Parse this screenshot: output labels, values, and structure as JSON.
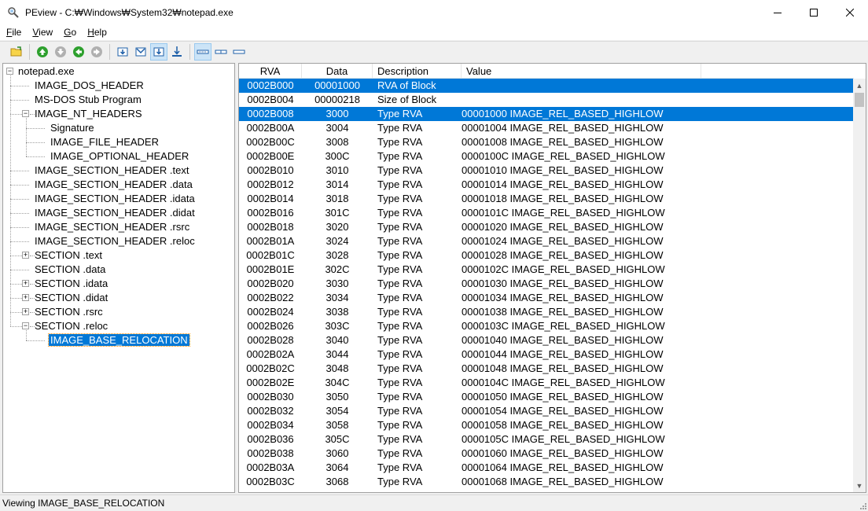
{
  "window": {
    "title": "PEview - C:₩Windows₩System32₩notepad.exe",
    "app_icon": "magnifier-icon",
    "controls": [
      "minimize-icon",
      "maximize-icon",
      "close-icon"
    ]
  },
  "menu": [
    {
      "label": "File",
      "accel": "F",
      "rest": "ile"
    },
    {
      "label": "View",
      "accel": "V",
      "rest": "iew"
    },
    {
      "label": "Go",
      "accel": "G",
      "rest": "o"
    },
    {
      "label": "Help",
      "accel": "H",
      "rest": "elp"
    }
  ],
  "toolbar": {
    "buttons": [
      {
        "name": "open-file-icon"
      },
      {
        "name": "go-up-icon"
      },
      {
        "name": "go-down-icon"
      },
      {
        "name": "go-back-icon"
      },
      {
        "name": "go-forward-icon"
      },
      {
        "name": "view-byte-icon"
      },
      {
        "name": "view-word-icon"
      },
      {
        "name": "view-dword-icon",
        "pressed": true
      },
      {
        "name": "view-address-icon"
      },
      {
        "name": "view-details-icon",
        "pressed": true
      },
      {
        "name": "view-compact-icon"
      },
      {
        "name": "view-single-icon"
      }
    ]
  },
  "tree": {
    "items": [
      {
        "label": "notepad.exe",
        "level": 0,
        "expander": "-"
      },
      {
        "label": "IMAGE_DOS_HEADER",
        "level": 1
      },
      {
        "label": "MS-DOS Stub Program",
        "level": 1
      },
      {
        "label": "IMAGE_NT_HEADERS",
        "level": 1,
        "expander": "-"
      },
      {
        "label": "Signature",
        "level": 2
      },
      {
        "label": "IMAGE_FILE_HEADER",
        "level": 2
      },
      {
        "label": "IMAGE_OPTIONAL_HEADER",
        "level": 2
      },
      {
        "label": "IMAGE_SECTION_HEADER .text",
        "level": 1
      },
      {
        "label": "IMAGE_SECTION_HEADER .data",
        "level": 1
      },
      {
        "label": "IMAGE_SECTION_HEADER .idata",
        "level": 1
      },
      {
        "label": "IMAGE_SECTION_HEADER .didat",
        "level": 1
      },
      {
        "label": "IMAGE_SECTION_HEADER .rsrc",
        "level": 1
      },
      {
        "label": "IMAGE_SECTION_HEADER .reloc",
        "level": 1
      },
      {
        "label": "SECTION .text",
        "level": 1,
        "expander": "+"
      },
      {
        "label": "SECTION .data",
        "level": 1
      },
      {
        "label": "SECTION .idata",
        "level": 1,
        "expander": "+"
      },
      {
        "label": "SECTION .didat",
        "level": 1,
        "expander": "+"
      },
      {
        "label": "SECTION .rsrc",
        "level": 1,
        "expander": "+"
      },
      {
        "label": "SECTION .reloc",
        "level": 1,
        "expander": "-"
      },
      {
        "label": "IMAGE_BASE_RELOCATION",
        "level": 2,
        "selected": true
      }
    ]
  },
  "list": {
    "columns": [
      "RVA",
      "Data",
      "Description",
      "Value"
    ],
    "rows": [
      {
        "rva": "0002B000",
        "data": "00001000",
        "desc": "RVA of Block",
        "value": "",
        "selected": true
      },
      {
        "rva": "0002B004",
        "data": "00000218",
        "desc": "Size of Block",
        "value": ""
      },
      {
        "rva": "0002B008",
        "data": "3000",
        "desc": "Type RVA",
        "value": "00001000 IMAGE_REL_BASED_HIGHLOW",
        "selected": true
      },
      {
        "rva": "0002B00A",
        "data": "3004",
        "desc": "Type RVA",
        "value": "00001004 IMAGE_REL_BASED_HIGHLOW"
      },
      {
        "rva": "0002B00C",
        "data": "3008",
        "desc": "Type RVA",
        "value": "00001008 IMAGE_REL_BASED_HIGHLOW"
      },
      {
        "rva": "0002B00E",
        "data": "300C",
        "desc": "Type RVA",
        "value": "0000100C IMAGE_REL_BASED_HIGHLOW"
      },
      {
        "rva": "0002B010",
        "data": "3010",
        "desc": "Type RVA",
        "value": "00001010 IMAGE_REL_BASED_HIGHLOW"
      },
      {
        "rva": "0002B012",
        "data": "3014",
        "desc": "Type RVA",
        "value": "00001014 IMAGE_REL_BASED_HIGHLOW"
      },
      {
        "rva": "0002B014",
        "data": "3018",
        "desc": "Type RVA",
        "value": "00001018 IMAGE_REL_BASED_HIGHLOW"
      },
      {
        "rva": "0002B016",
        "data": "301C",
        "desc": "Type RVA",
        "value": "0000101C IMAGE_REL_BASED_HIGHLOW"
      },
      {
        "rva": "0002B018",
        "data": "3020",
        "desc": "Type RVA",
        "value": "00001020 IMAGE_REL_BASED_HIGHLOW"
      },
      {
        "rva": "0002B01A",
        "data": "3024",
        "desc": "Type RVA",
        "value": "00001024 IMAGE_REL_BASED_HIGHLOW"
      },
      {
        "rva": "0002B01C",
        "data": "3028",
        "desc": "Type RVA",
        "value": "00001028 IMAGE_REL_BASED_HIGHLOW"
      },
      {
        "rva": "0002B01E",
        "data": "302C",
        "desc": "Type RVA",
        "value": "0000102C IMAGE_REL_BASED_HIGHLOW"
      },
      {
        "rva": "0002B020",
        "data": "3030",
        "desc": "Type RVA",
        "value": "00001030 IMAGE_REL_BASED_HIGHLOW"
      },
      {
        "rva": "0002B022",
        "data": "3034",
        "desc": "Type RVA",
        "value": "00001034 IMAGE_REL_BASED_HIGHLOW"
      },
      {
        "rva": "0002B024",
        "data": "3038",
        "desc": "Type RVA",
        "value": "00001038 IMAGE_REL_BASED_HIGHLOW"
      },
      {
        "rva": "0002B026",
        "data": "303C",
        "desc": "Type RVA",
        "value": "0000103C IMAGE_REL_BASED_HIGHLOW"
      },
      {
        "rva": "0002B028",
        "data": "3040",
        "desc": "Type RVA",
        "value": "00001040 IMAGE_REL_BASED_HIGHLOW"
      },
      {
        "rva": "0002B02A",
        "data": "3044",
        "desc": "Type RVA",
        "value": "00001044 IMAGE_REL_BASED_HIGHLOW"
      },
      {
        "rva": "0002B02C",
        "data": "3048",
        "desc": "Type RVA",
        "value": "00001048 IMAGE_REL_BASED_HIGHLOW"
      },
      {
        "rva": "0002B02E",
        "data": "304C",
        "desc": "Type RVA",
        "value": "0000104C IMAGE_REL_BASED_HIGHLOW"
      },
      {
        "rva": "0002B030",
        "data": "3050",
        "desc": "Type RVA",
        "value": "00001050 IMAGE_REL_BASED_HIGHLOW"
      },
      {
        "rva": "0002B032",
        "data": "3054",
        "desc": "Type RVA",
        "value": "00001054 IMAGE_REL_BASED_HIGHLOW"
      },
      {
        "rva": "0002B034",
        "data": "3058",
        "desc": "Type RVA",
        "value": "00001058 IMAGE_REL_BASED_HIGHLOW"
      },
      {
        "rva": "0002B036",
        "data": "305C",
        "desc": "Type RVA",
        "value": "0000105C IMAGE_REL_BASED_HIGHLOW"
      },
      {
        "rva": "0002B038",
        "data": "3060",
        "desc": "Type RVA",
        "value": "00001060 IMAGE_REL_BASED_HIGHLOW"
      },
      {
        "rva": "0002B03A",
        "data": "3064",
        "desc": "Type RVA",
        "value": "00001064 IMAGE_REL_BASED_HIGHLOW"
      },
      {
        "rva": "0002B03C",
        "data": "3068",
        "desc": "Type RVA",
        "value": "00001068 IMAGE_REL_BASED_HIGHLOW"
      }
    ]
  },
  "status": {
    "text": "Viewing IMAGE_BASE_RELOCATION"
  },
  "colors": {
    "selection": "#0078d7",
    "window_bg": "#f0f0f0",
    "pane_bg": "#ffffff"
  }
}
